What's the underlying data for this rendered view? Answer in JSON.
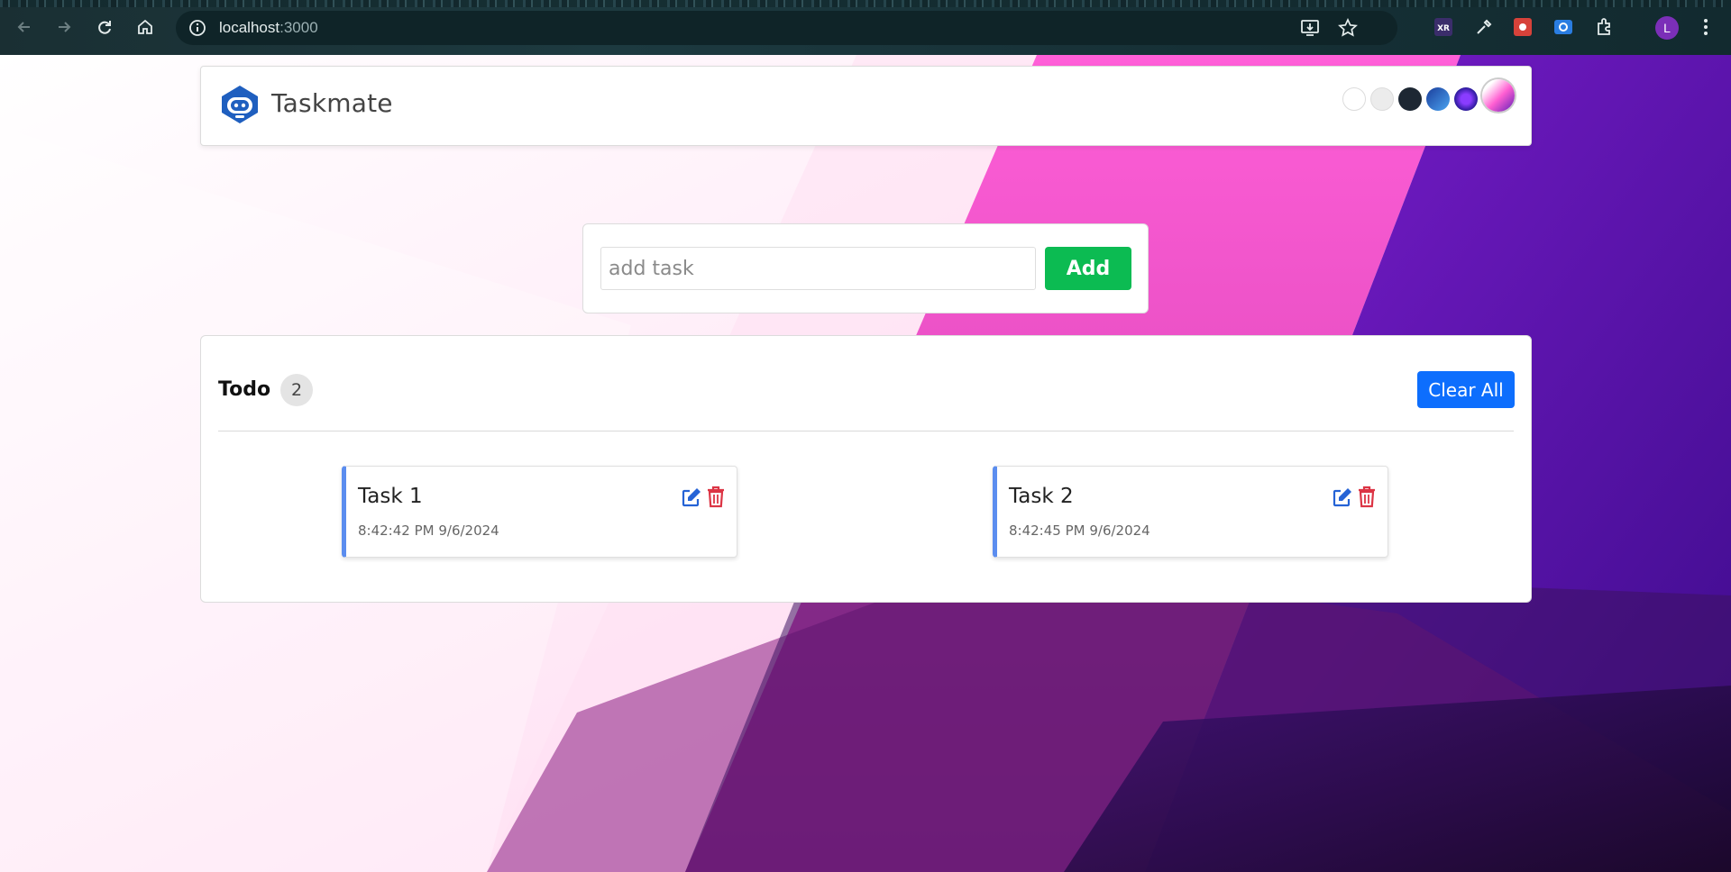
{
  "browser": {
    "url_host": "localhost",
    "url_port": ":3000",
    "profile_initial": "L",
    "icons": [
      "back-arrow-icon",
      "forward-arrow-icon",
      "reload-icon",
      "home-icon",
      "site-info-icon",
      "install-app-icon",
      "bookmark-star-icon",
      "xr-extension-icon",
      "eyedropper-extension-icon",
      "red-extension-icon",
      "screen-extension-icon",
      "puzzle-extensions-icon",
      "kebab-menu-icon"
    ]
  },
  "header": {
    "brand": "Taskmate",
    "theme_colors": [
      "#ffffff",
      "#ececec",
      "#1d2733",
      "#2f6fd0",
      "#4b23a8",
      "#ff5fd2"
    ]
  },
  "add_form": {
    "placeholder": "add task",
    "value": "",
    "button_label": "Add"
  },
  "todo": {
    "title": "Todo",
    "count": "2",
    "clear_label": "Clear All",
    "tasks": [
      {
        "title": "Task 1",
        "time": "8:42:42 PM 9/6/2024"
      },
      {
        "title": "Task 2",
        "time": "8:42:45 PM 9/6/2024"
      }
    ]
  },
  "colors": {
    "accent_green": "#0cbb52",
    "accent_blue": "#0d6efd",
    "task_border": "#5b8def",
    "delete_red": "#dc3545"
  }
}
